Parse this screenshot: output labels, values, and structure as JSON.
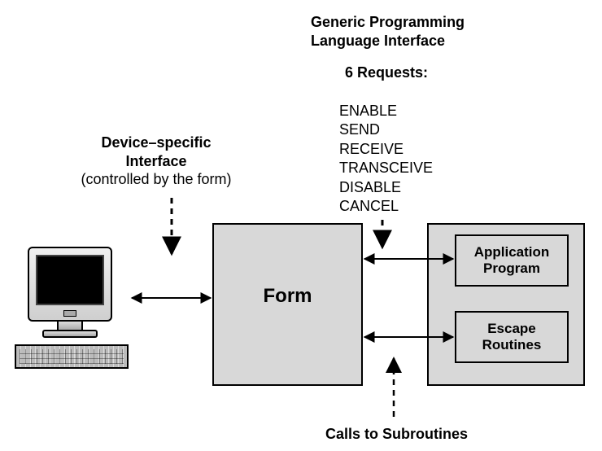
{
  "header": {
    "title_line1": "Generic Programming",
    "title_line2": "Language Interface",
    "requests_heading": "6 Requests:"
  },
  "requests": {
    "items": {
      "0": "ENABLE",
      "1": "SEND",
      "2": "RECEIVE",
      "3": "TRANSCEIVE",
      "4": "DISABLE",
      "5": "CANCEL"
    }
  },
  "left_label": {
    "line1": "Device–specific",
    "line2": "Interface",
    "line3": "(controlled by the form)"
  },
  "blocks": {
    "form": "Form",
    "app_line1": "Application",
    "app_line2": "Program",
    "escape_line1": "Escape",
    "escape_line2": "Routines"
  },
  "bottom_label": "Calls to Subroutines"
}
